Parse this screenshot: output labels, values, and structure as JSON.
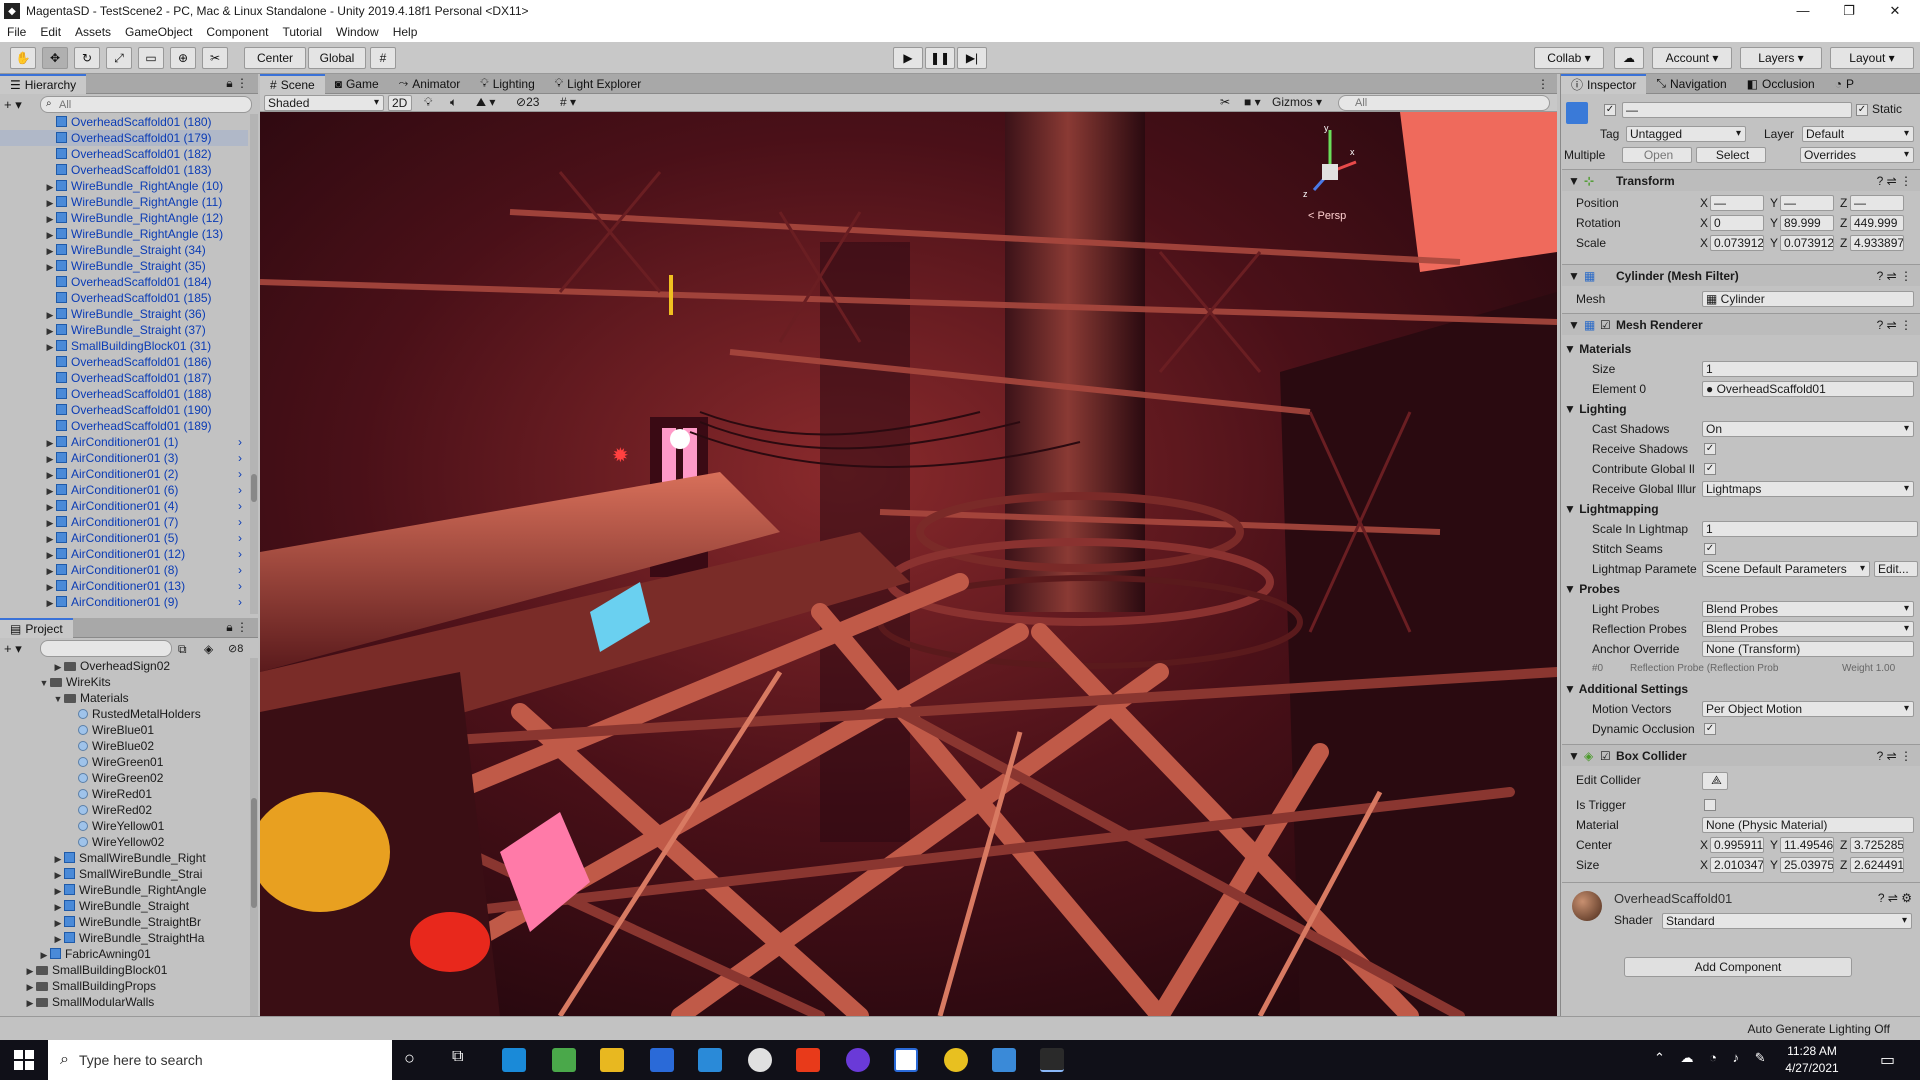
{
  "title": "MagentaSD - TestScene2 - PC, Mac & Linux Standalone - Unity 2019.4.18f1 Personal <DX11>",
  "window_controls": [
    "—",
    "❐",
    "✕"
  ],
  "menu": [
    "File",
    "Edit",
    "Assets",
    "GameObject",
    "Component",
    "Tutorial",
    "Window",
    "Help"
  ],
  "toolbar": {
    "pivot": "Center",
    "space": "Global",
    "collab": "Collab",
    "account": "Account",
    "layers": "Layers",
    "layout": "Layout"
  },
  "hierarchy": {
    "tab": "Hierarchy",
    "search_placeholder": "All",
    "items": [
      {
        "label": "OverheadScaffold01 (180)",
        "expand": false,
        "right": false
      },
      {
        "label": "OverheadScaffold01 (179)",
        "expand": false,
        "right": false
      },
      {
        "label": "OverheadScaffold01 (182)",
        "expand": false,
        "right": false
      },
      {
        "label": "OverheadScaffold01 (183)",
        "expand": false,
        "right": false
      },
      {
        "label": "WireBundle_RightAngle (10)",
        "expand": true,
        "right": false
      },
      {
        "label": "WireBundle_RightAngle (11)",
        "expand": true,
        "right": false
      },
      {
        "label": "WireBundle_RightAngle (12)",
        "expand": true,
        "right": false
      },
      {
        "label": "WireBundle_RightAngle (13)",
        "expand": true,
        "right": false
      },
      {
        "label": "WireBundle_Straight (34)",
        "expand": true,
        "right": false
      },
      {
        "label": "WireBundle_Straight (35)",
        "expand": true,
        "right": false
      },
      {
        "label": "OverheadScaffold01 (184)",
        "expand": false,
        "right": false
      },
      {
        "label": "OverheadScaffold01 (185)",
        "expand": false,
        "right": false
      },
      {
        "label": "WireBundle_Straight (36)",
        "expand": true,
        "right": false
      },
      {
        "label": "WireBundle_Straight (37)",
        "expand": true,
        "right": false
      },
      {
        "label": "SmallBuildingBlock01 (31)",
        "expand": true,
        "right": false
      },
      {
        "label": "OverheadScaffold01 (186)",
        "expand": false,
        "right": false
      },
      {
        "label": "OverheadScaffold01 (187)",
        "expand": false,
        "right": false
      },
      {
        "label": "OverheadScaffold01 (188)",
        "expand": false,
        "right": false
      },
      {
        "label": "OverheadScaffold01 (190)",
        "expand": false,
        "right": false
      },
      {
        "label": "OverheadScaffold01 (189)",
        "expand": false,
        "right": false
      },
      {
        "label": "AirConditioner01 (1)",
        "expand": true,
        "right": true
      },
      {
        "label": "AirConditioner01 (3)",
        "expand": true,
        "right": true
      },
      {
        "label": "AirConditioner01 (2)",
        "expand": true,
        "right": true
      },
      {
        "label": "AirConditioner01 (6)",
        "expand": true,
        "right": true
      },
      {
        "label": "AirConditioner01 (4)",
        "expand": true,
        "right": true
      },
      {
        "label": "AirConditioner01 (7)",
        "expand": true,
        "right": true
      },
      {
        "label": "AirConditioner01 (5)",
        "expand": true,
        "right": true
      },
      {
        "label": "AirConditioner01 (12)",
        "expand": true,
        "right": true
      },
      {
        "label": "AirConditioner01 (8)",
        "expand": true,
        "right": true
      },
      {
        "label": "AirConditioner01 (13)",
        "expand": true,
        "right": true
      },
      {
        "label": "AirConditioner01 (9)",
        "expand": true,
        "right": true
      }
    ]
  },
  "project": {
    "tab": "Project",
    "count": "8",
    "items": [
      {
        "label": "OverheadSign02",
        "indent": 3,
        "type": "folder",
        "arrow": "▶"
      },
      {
        "label": "WireKits",
        "indent": 2,
        "type": "folder",
        "arrow": "▼"
      },
      {
        "label": "Materials",
        "indent": 3,
        "type": "folder",
        "arrow": "▼"
      },
      {
        "label": "RustedMetalHolders",
        "indent": 4,
        "type": "mat",
        "arrow": ""
      },
      {
        "label": "WireBlue01",
        "indent": 4,
        "type": "mat",
        "arrow": ""
      },
      {
        "label": "WireBlue02",
        "indent": 4,
        "type": "mat",
        "arrow": ""
      },
      {
        "label": "WireGreen01",
        "indent": 4,
        "type": "mat",
        "arrow": ""
      },
      {
        "label": "WireGreen02",
        "indent": 4,
        "type": "mat",
        "arrow": ""
      },
      {
        "label": "WireRed01",
        "indent": 4,
        "type": "mat",
        "arrow": ""
      },
      {
        "label": "WireRed02",
        "indent": 4,
        "type": "mat",
        "arrow": ""
      },
      {
        "label": "WireYellow01",
        "indent": 4,
        "type": "mat",
        "arrow": ""
      },
      {
        "label": "WireYellow02",
        "indent": 4,
        "type": "mat",
        "arrow": ""
      },
      {
        "label": "SmallWireBundle_Right",
        "indent": 3,
        "type": "cube",
        "arrow": "▶"
      },
      {
        "label": "SmallWireBundle_Strai",
        "indent": 3,
        "type": "cube",
        "arrow": "▶"
      },
      {
        "label": "WireBundle_RightAngle",
        "indent": 3,
        "type": "cube",
        "arrow": "▶"
      },
      {
        "label": "WireBundle_Straight",
        "indent": 3,
        "type": "cube",
        "arrow": "▶"
      },
      {
        "label": "WireBundle_StraightBr",
        "indent": 3,
        "type": "cube",
        "arrow": "▶"
      },
      {
        "label": "WireBundle_StraightHa",
        "indent": 3,
        "type": "cube",
        "arrow": "▶"
      },
      {
        "label": "FabricAwning01",
        "indent": 2,
        "type": "cube",
        "arrow": "▶"
      },
      {
        "label": "SmallBuildingBlock01",
        "indent": 1,
        "type": "folder",
        "arrow": "▶"
      },
      {
        "label": "SmallBuildingProps",
        "indent": 1,
        "type": "folder",
        "arrow": "▶"
      },
      {
        "label": "SmallModularWalls",
        "indent": 1,
        "type": "folder",
        "arrow": "▶"
      }
    ]
  },
  "scene": {
    "tabs": [
      "Scene",
      "Game",
      "Animator",
      "Lighting",
      "Light Explorer"
    ],
    "shading": "Shaded",
    "mode2d": "2D",
    "fx_count": "23",
    "gizmos": "Gizmos",
    "search_placeholder": "All",
    "persp": "< Persp"
  },
  "inspector": {
    "tabs": [
      "Inspector",
      "Navigation",
      "Occlusion",
      "P"
    ],
    "name_value": "—",
    "static_label": "Static",
    "tag_label": "Tag",
    "tag_value": "Untagged",
    "layer_label": "Layer",
    "layer_value": "Default",
    "multiple_label": "Multiple",
    "open_btn": "Open",
    "select_btn": "Select",
    "overrides_btn": "Overrides",
    "transform": {
      "title": "Transform",
      "position_label": "Position",
      "rotation_label": "Rotation",
      "scale_label": "Scale",
      "position": [
        "—",
        "—",
        "—"
      ],
      "rotation": [
        "0",
        "89.999",
        "449.999"
      ],
      "scale": [
        "0.073912",
        "0.073912",
        "4.933897"
      ]
    },
    "mesh_filter": {
      "title": "Cylinder (Mesh Filter)",
      "mesh_label": "Mesh",
      "mesh_value": "Cylinder"
    },
    "mesh_renderer": {
      "title": "Mesh Renderer",
      "materials": "Materials",
      "size_label": "Size",
      "size_value": "1",
      "element0_label": "Element 0",
      "element0_value": "OverheadScaffold01",
      "lighting": "Lighting",
      "cast_shadows_label": "Cast Shadows",
      "cast_shadows_value": "On",
      "receive_shadows_label": "Receive Shadows",
      "contribute_gi_label": "Contribute Global Il",
      "receive_gi_label": "Receive Global Illur",
      "receive_gi_value": "Lightmaps",
      "lightmapping": "Lightmapping",
      "scale_lightmap_label": "Scale In Lightmap",
      "scale_lightmap_value": "1",
      "stitch_seams_label": "Stitch Seams",
      "lightmap_params_label": "Lightmap Paramete",
      "lightmap_params_value": "Scene Default Parameters",
      "edit_btn": "Edit...",
      "probes": "Probes",
      "light_probes_label": "Light Probes",
      "light_probes_value": "Blend Probes",
      "reflection_probes_label": "Reflection Probes",
      "reflection_probes_value": "Blend Probes",
      "anchor_override_label": "Anchor Override",
      "anchor_override_value": "None (Transform)",
      "probe_index": "#0",
      "probe_info": "Reflection Probe (Reflection Prob",
      "probe_weight": "Weight 1.00",
      "additional": "Additional Settings",
      "motion_vectors_label": "Motion Vectors",
      "motion_vectors_value": "Per Object Motion",
      "dynamic_occlusion_label": "Dynamic Occlusion"
    },
    "box_collider": {
      "title": "Box Collider",
      "edit_collider_label": "Edit Collider",
      "is_trigger_label": "Is Trigger",
      "material_label": "Material",
      "material_value": "None (Physic Material)",
      "center_label": "Center",
      "center": [
        "0.995911",
        "11.49546",
        "3.725285"
      ],
      "size_label": "Size",
      "size": [
        "2.010347",
        "25.03975",
        "2.624491"
      ]
    },
    "material": {
      "name": "OverheadScaffold01",
      "shader_label": "Shader",
      "shader_value": "Standard"
    },
    "add_component": "Add Component"
  },
  "status": {
    "text": "Auto Generate Lighting Off"
  },
  "taskbar": {
    "search_placeholder": "Type here to search",
    "time": "11:28 AM",
    "date": "4/27/2021"
  },
  "colors": {
    "accent": "#3a72d8",
    "hierarchy_text": "#0b3cb5",
    "scene_bg": "#3a0c18",
    "taskbar": "#101018"
  }
}
